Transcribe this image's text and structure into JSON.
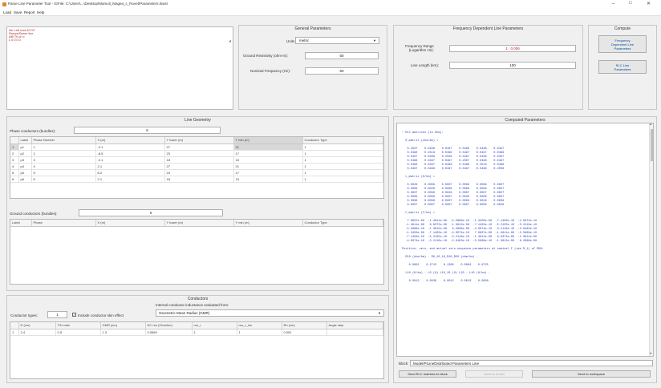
{
  "window": {
    "title": "Parse Line Parameter Tool - IGFile: C:\\Users\\...\\Desktop\\Mamoli_Magea_c_Rovet\\Parameters.lnwsl",
    "controls": {
      "minimize": "–",
      "maximize": "□",
      "close": "✕"
    }
  },
  "menu": [
    "Load",
    "Save",
    "Report",
    "Help"
  ],
  "input_text": {
    "lines": [
      "Ale Laff mod 40747",
      "Rweps/Sewer line",
      "Afff-Th orl c",
      "L.0.0.0.0"
    ]
  },
  "general_parameters": {
    "title": "General Parameters",
    "units_label": "Units",
    "units_value": "metric",
    "ground_resistivity_label": "Ground Resistivity (ohm-m):",
    "ground_resistivity_value": "50",
    "nominal_frequency_label": "Nominal Frequency (Hz):",
    "nominal_frequency_value": "60"
  },
  "frequency_params": {
    "title": "Frequency Dependent Line Parameters",
    "range_label": "Frequency Range\n(Logarithm Hz):",
    "range_value": "1 : 0.006",
    "line_length_label": "Line Length (km):",
    "line_length_value": "100"
  },
  "compute": {
    "title": "Compute",
    "button1": "Frequency\nDependent Line\nParameters",
    "button2": "RLC Line\nParameters"
  },
  "line_geometry": {
    "title": "Line Geometry",
    "phase_conductors_label": "Phase conductors (bundles):",
    "phase_conductors_value": "6",
    "columns": [
      "Label",
      "Phase Number",
      "X (m)",
      "Y tower (m)",
      "Y min (m)",
      "Conductor Type"
    ],
    "rows": [
      [
        "p1",
        "1",
        "-2.1",
        "27",
        "21",
        "1"
      ],
      [
        "p2",
        "2",
        "-8.5",
        "23",
        "17",
        "1"
      ],
      [
        "p3",
        "3",
        "-2.1",
        "18",
        "15",
        "1"
      ],
      [
        "p4",
        "4",
        "2.1",
        "27",
        "21",
        "1"
      ],
      [
        "p5",
        "5",
        "8.2",
        "23",
        "17",
        "1"
      ],
      [
        "p6",
        "6",
        "2.1",
        "18",
        "15",
        "1"
      ]
    ],
    "ground_conductors_label": "Ground conductors (bundles):",
    "ground_conductors_value": "0",
    "ground_columns": [
      "Label",
      "Phase",
      "X (m)",
      "Y tower (m)",
      "Y min (m)",
      "Conductor Type"
    ]
  },
  "conductors": {
    "title": "Conductors",
    "types_label": "Conductor types:",
    "types_value": "1",
    "include_skin_label": "Include conductor skin effect",
    "internal_label": "Internal conductor inductance evaluated from:",
    "internal_value": "Geometric Mean Radius (GMR)",
    "columns": [
      "D (cm)",
      "T/D ratio",
      "GMR (cm)",
      "DC res (Ohm/km)",
      "mu_r",
      "mu_r_ins",
      "Rh (cm)",
      "Angle step"
    ],
    "row": [
      "1",
      "2.4",
      "0.5",
      "1.3",
      "0.0569",
      "1",
      "1",
      "0.051",
      ""
    ]
  },
  "computed_parameters": {
    "title": "Computed Parameters",
    "console_lines": [
      "* RLC matrices (in Ohm):",
      "",
      "  R_matrix (ohm/km) =",
      "",
      "   0.2507    0.0498    0.0497    0.0496    0.0498    0.0497",
      "   0.0498    0.2516    0.0496    0.0497    0.0497    0.0496",
      "   0.0497    0.0496    0.2506    0.0497    0.0496    0.0497",
      "   0.0496    0.0497    0.0497    0.2507    0.0498    0.0497",
      "   0.0498    0.0497    0.0496    0.0498    0.2516    0.0496",
      "   0.0497    0.0496    0.0497    0.0497    0.0496    0.2506",
      "",
      "  L_matrix (H/km) =",
      "",
      "   0.0026    0.0009    0.0007    0.0009    0.0008    0.0007",
      "   0.0009    0.0026    0.0009    0.0008    0.0008    0.0007",
      "   0.0007    0.0009    0.0026    0.0007    0.0007    0.0007",
      "   0.0009    0.0008    0.0007    0.0026    0.0009    0.0007",
      "   0.0008    0.0008    0.0007    0.0009    0.0026    0.0009",
      "   0.0007    0.0007    0.0007    0.0007    0.0009    0.0026",
      "",
      "  C_matrix (F/km) =",
      "",
      "   7.0607e-09  -1.4811e-09  -5.5688e-10  -1.3450e-09  -7.1403e-10  -4.0074e-10",
      "  -1.4811e-09   6.8372e-09  -1.3612e-09  -7.1403e-10  -5.2125e-10  -3.2116e-10",
      "  -5.5688e-10  -1.3612e-09   6.2668e-09  -4.0074e-10  -3.2116e-10  -2.8183e-10",
      "  -1.3450e-09  -7.1403e-10  -4.0074e-10   7.0607e-09  -1.4811e-09  -5.5688e-10",
      "  -7.1403e-10  -5.2125e-10  -3.2116e-10  -1.4811e-09   6.8372e-09  -1.3612e-09",
      "  -4.0074e-10  -3.2116e-10  -2.8183e-10  -5.5688e-10  -1.3612e-09   6.2668e-09",
      "",
      "Positive, zero, and mutual zero-sequence parameters at nominal F (see R_1) of RNG:",
      "",
      "  R10 (ohm/km) - R0_10_10_R10_R20 (ohm/km) -",
      "",
      "    0.0062    0.2715    0.1366    0.0064    0.0725",
      "",
      "  L10 (H/km) - L0 (H) L10_10 (H) L20 - L10 (H/km) -",
      "",
      "    0.0013    0.0036    0.0012    0.0013    0.0008"
    ],
    "block_label": "Block:",
    "block_value": "Model/PILineDistributed Parameters Line",
    "send_rlc_button": "Send RLC matrices to block",
    "send_hidden": "Send to model",
    "apply_button": "Send to workspace"
  }
}
